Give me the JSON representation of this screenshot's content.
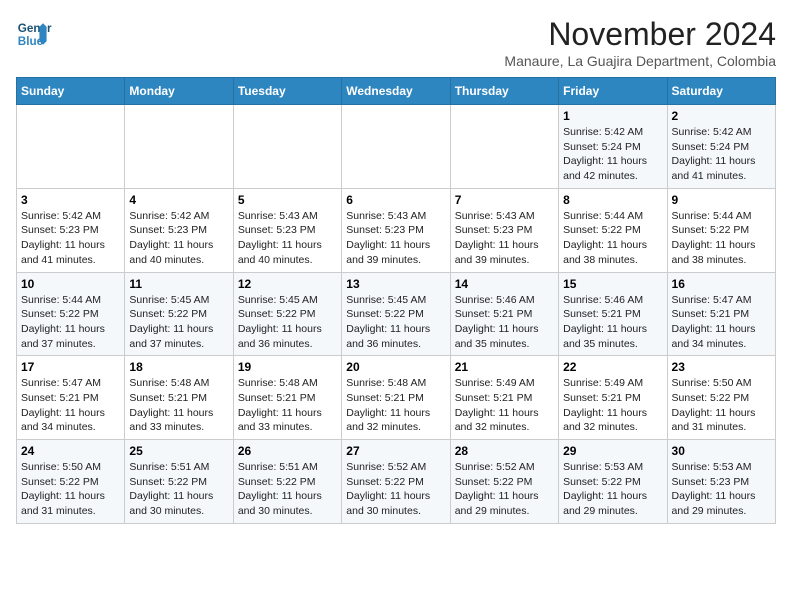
{
  "header": {
    "logo_line1": "General",
    "logo_line2": "Blue",
    "month": "November 2024",
    "location": "Manaure, La Guajira Department, Colombia"
  },
  "weekdays": [
    "Sunday",
    "Monday",
    "Tuesday",
    "Wednesday",
    "Thursday",
    "Friday",
    "Saturday"
  ],
  "weeks": [
    [
      {
        "day": "",
        "info": ""
      },
      {
        "day": "",
        "info": ""
      },
      {
        "day": "",
        "info": ""
      },
      {
        "day": "",
        "info": ""
      },
      {
        "day": "",
        "info": ""
      },
      {
        "day": "1",
        "info": "Sunrise: 5:42 AM\nSunset: 5:24 PM\nDaylight: 11 hours\nand 42 minutes."
      },
      {
        "day": "2",
        "info": "Sunrise: 5:42 AM\nSunset: 5:24 PM\nDaylight: 11 hours\nand 41 minutes."
      }
    ],
    [
      {
        "day": "3",
        "info": "Sunrise: 5:42 AM\nSunset: 5:23 PM\nDaylight: 11 hours\nand 41 minutes."
      },
      {
        "day": "4",
        "info": "Sunrise: 5:42 AM\nSunset: 5:23 PM\nDaylight: 11 hours\nand 40 minutes."
      },
      {
        "day": "5",
        "info": "Sunrise: 5:43 AM\nSunset: 5:23 PM\nDaylight: 11 hours\nand 40 minutes."
      },
      {
        "day": "6",
        "info": "Sunrise: 5:43 AM\nSunset: 5:23 PM\nDaylight: 11 hours\nand 39 minutes."
      },
      {
        "day": "7",
        "info": "Sunrise: 5:43 AM\nSunset: 5:23 PM\nDaylight: 11 hours\nand 39 minutes."
      },
      {
        "day": "8",
        "info": "Sunrise: 5:44 AM\nSunset: 5:22 PM\nDaylight: 11 hours\nand 38 minutes."
      },
      {
        "day": "9",
        "info": "Sunrise: 5:44 AM\nSunset: 5:22 PM\nDaylight: 11 hours\nand 38 minutes."
      }
    ],
    [
      {
        "day": "10",
        "info": "Sunrise: 5:44 AM\nSunset: 5:22 PM\nDaylight: 11 hours\nand 37 minutes."
      },
      {
        "day": "11",
        "info": "Sunrise: 5:45 AM\nSunset: 5:22 PM\nDaylight: 11 hours\nand 37 minutes."
      },
      {
        "day": "12",
        "info": "Sunrise: 5:45 AM\nSunset: 5:22 PM\nDaylight: 11 hours\nand 36 minutes."
      },
      {
        "day": "13",
        "info": "Sunrise: 5:45 AM\nSunset: 5:22 PM\nDaylight: 11 hours\nand 36 minutes."
      },
      {
        "day": "14",
        "info": "Sunrise: 5:46 AM\nSunset: 5:21 PM\nDaylight: 11 hours\nand 35 minutes."
      },
      {
        "day": "15",
        "info": "Sunrise: 5:46 AM\nSunset: 5:21 PM\nDaylight: 11 hours\nand 35 minutes."
      },
      {
        "day": "16",
        "info": "Sunrise: 5:47 AM\nSunset: 5:21 PM\nDaylight: 11 hours\nand 34 minutes."
      }
    ],
    [
      {
        "day": "17",
        "info": "Sunrise: 5:47 AM\nSunset: 5:21 PM\nDaylight: 11 hours\nand 34 minutes."
      },
      {
        "day": "18",
        "info": "Sunrise: 5:48 AM\nSunset: 5:21 PM\nDaylight: 11 hours\nand 33 minutes."
      },
      {
        "day": "19",
        "info": "Sunrise: 5:48 AM\nSunset: 5:21 PM\nDaylight: 11 hours\nand 33 minutes."
      },
      {
        "day": "20",
        "info": "Sunrise: 5:48 AM\nSunset: 5:21 PM\nDaylight: 11 hours\nand 32 minutes."
      },
      {
        "day": "21",
        "info": "Sunrise: 5:49 AM\nSunset: 5:21 PM\nDaylight: 11 hours\nand 32 minutes."
      },
      {
        "day": "22",
        "info": "Sunrise: 5:49 AM\nSunset: 5:21 PM\nDaylight: 11 hours\nand 32 minutes."
      },
      {
        "day": "23",
        "info": "Sunrise: 5:50 AM\nSunset: 5:22 PM\nDaylight: 11 hours\nand 31 minutes."
      }
    ],
    [
      {
        "day": "24",
        "info": "Sunrise: 5:50 AM\nSunset: 5:22 PM\nDaylight: 11 hours\nand 31 minutes."
      },
      {
        "day": "25",
        "info": "Sunrise: 5:51 AM\nSunset: 5:22 PM\nDaylight: 11 hours\nand 30 minutes."
      },
      {
        "day": "26",
        "info": "Sunrise: 5:51 AM\nSunset: 5:22 PM\nDaylight: 11 hours\nand 30 minutes."
      },
      {
        "day": "27",
        "info": "Sunrise: 5:52 AM\nSunset: 5:22 PM\nDaylight: 11 hours\nand 30 minutes."
      },
      {
        "day": "28",
        "info": "Sunrise: 5:52 AM\nSunset: 5:22 PM\nDaylight: 11 hours\nand 29 minutes."
      },
      {
        "day": "29",
        "info": "Sunrise: 5:53 AM\nSunset: 5:22 PM\nDaylight: 11 hours\nand 29 minutes."
      },
      {
        "day": "30",
        "info": "Sunrise: 5:53 AM\nSunset: 5:23 PM\nDaylight: 11 hours\nand 29 minutes."
      }
    ]
  ]
}
